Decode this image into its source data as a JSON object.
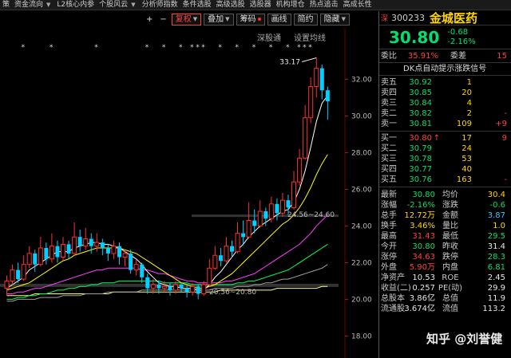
{
  "menu": [
    {
      "label": "策",
      "caret": false
    },
    {
      "label": "资金流向",
      "caret": true
    },
    {
      "label": "L2核心内参",
      "caret": false
    },
    {
      "label": "个股风云",
      "caret": true
    },
    {
      "label": "分析师指数",
      "caret": false
    },
    {
      "label": "条件选股",
      "caret": false
    },
    {
      "label": "高级选股",
      "caret": false
    },
    {
      "label": "选股器",
      "caret": false
    },
    {
      "label": "机构增仓",
      "caret": false
    },
    {
      "label": "热点追击",
      "caret": false
    },
    {
      "label": "高成长性",
      "caret": false
    }
  ],
  "toolbar": {
    "plus": "+",
    "minus": "−",
    "fuquan": "复权",
    "diejia": "叠加",
    "chouma": "筹码",
    "huaxian": "画线",
    "jianyue": "简约",
    "yincang": "隐藏"
  },
  "chart": {
    "deep_link": "深股通",
    "settings": "设置均线",
    "max_label": "33.17",
    "mid_label": "24.56~24.60",
    "low_label": "20.56~20.80",
    "ticks": [
      {
        "v": 32.0,
        "label": "32.00"
      },
      {
        "v": 30.0,
        "label": "30.00"
      },
      {
        "v": 28.0,
        "label": "28.00"
      },
      {
        "v": 26.0,
        "label": "26.00"
      },
      {
        "v": 24.0,
        "label": "24.00"
      },
      {
        "v": 22.0,
        "label": "22.00"
      },
      {
        "v": 20.0,
        "label": "20.00"
      },
      {
        "v": 18.0,
        "label": "18.00"
      }
    ]
  },
  "chart_data": {
    "type": "candlestick",
    "title": "",
    "ylim": [
      16.8,
      34.8
    ],
    "candles": [
      [
        20.6,
        21.0,
        21.3,
        20.2
      ],
      [
        21.0,
        21.6,
        21.9,
        20.8
      ],
      [
        21.6,
        21.1,
        22.0,
        20.9
      ],
      [
        21.1,
        21.9,
        22.4,
        21.0
      ],
      [
        21.9,
        22.5,
        22.9,
        21.7
      ],
      [
        22.5,
        21.9,
        22.7,
        21.5
      ],
      [
        21.9,
        22.8,
        23.4,
        21.8
      ],
      [
        22.8,
        22.2,
        23.1,
        21.9
      ],
      [
        22.2,
        22.9,
        23.6,
        22.0
      ],
      [
        22.9,
        22.3,
        23.2,
        22.0
      ],
      [
        22.3,
        23.0,
        23.4,
        22.1
      ],
      [
        23.0,
        22.5,
        23.2,
        22.2
      ],
      [
        22.5,
        23.4,
        24.2,
        22.4
      ],
      [
        23.4,
        22.9,
        23.8,
        22.6
      ],
      [
        22.9,
        23.3,
        23.9,
        22.7
      ],
      [
        23.3,
        22.9,
        23.6,
        22.5
      ],
      [
        22.9,
        23.1,
        23.6,
        22.6
      ],
      [
        23.1,
        22.8,
        23.3,
        22.4
      ],
      [
        22.8,
        22.5,
        23.0,
        22.1
      ],
      [
        22.5,
        22.9,
        23.2,
        22.2
      ],
      [
        22.9,
        22.3,
        23.1,
        21.9
      ],
      [
        22.3,
        22.5,
        22.7,
        21.8
      ],
      [
        22.5,
        21.6,
        22.7,
        21.4
      ],
      [
        21.6,
        21.9,
        22.2,
        21.3
      ],
      [
        21.9,
        21.2,
        22.0,
        20.9
      ],
      [
        21.2,
        20.6,
        21.4,
        20.3
      ],
      [
        20.6,
        20.8,
        21.1,
        20.3
      ],
      [
        20.8,
        20.6,
        21.0,
        20.3
      ],
      [
        20.6,
        20.7,
        21.0,
        20.4
      ],
      [
        20.7,
        20.5,
        20.9,
        20.2
      ],
      [
        20.5,
        20.8,
        21.0,
        20.3
      ],
      [
        20.8,
        20.6,
        20.9,
        20.4
      ],
      [
        20.6,
        20.4,
        20.8,
        20.1
      ],
      [
        20.4,
        20.7,
        20.9,
        20.2
      ],
      [
        20.7,
        20.3,
        20.8,
        20.0
      ],
      [
        20.3,
        20.8,
        21.0,
        20.2
      ],
      [
        20.8,
        21.7,
        22.2,
        20.7
      ],
      [
        21.7,
        22.4,
        22.9,
        21.6
      ],
      [
        22.4,
        22.1,
        22.8,
        21.8
      ],
      [
        22.1,
        22.9,
        23.4,
        22.0
      ],
      [
        22.9,
        22.6,
        23.2,
        22.3
      ],
      [
        22.6,
        23.6,
        24.2,
        22.5
      ],
      [
        23.6,
        23.4,
        24.3,
        23.0
      ],
      [
        23.4,
        24.3,
        25.3,
        23.3
      ],
      [
        24.3,
        24.0,
        24.9,
        23.6
      ],
      [
        24.0,
        24.8,
        25.4,
        23.9
      ],
      [
        24.8,
        24.4,
        25.0,
        24.0
      ],
      [
        24.4,
        25.2,
        25.6,
        24.2
      ],
      [
        25.2,
        24.7,
        25.5,
        24.3
      ],
      [
        24.7,
        25.4,
        25.8,
        24.5
      ],
      [
        25.4,
        25.0,
        25.7,
        24.6
      ],
      [
        25.0,
        26.4,
        27.0,
        24.9
      ],
      [
        26.4,
        27.7,
        28.2,
        26.2
      ],
      [
        27.7,
        29.9,
        30.6,
        27.6
      ],
      [
        29.9,
        31.6,
        32.1,
        29.6
      ],
      [
        31.6,
        32.6,
        33.17,
        31.0
      ],
      [
        32.6,
        31.4,
        32.8,
        30.9
      ],
      [
        31.4,
        30.8,
        31.6,
        29.8
      ]
    ],
    "ma5": [
      20.6,
      20.8,
      21.0,
      21.2,
      21.6,
      21.8,
      22.0,
      22.2,
      22.4,
      22.6,
      22.6,
      22.6,
      22.8,
      22.9,
      23.0,
      23.1,
      23.1,
      23.0,
      23.0,
      22.9,
      22.8,
      22.6,
      22.4,
      22.2,
      21.9,
      21.5,
      21.2,
      20.9,
      20.8,
      20.7,
      20.7,
      20.6,
      20.6,
      20.6,
      20.5,
      20.5,
      20.8,
      21.2,
      21.5,
      21.9,
      22.3,
      22.7,
      23.0,
      23.4,
      23.7,
      24.0,
      24.2,
      24.4,
      24.6,
      24.8,
      24.9,
      25.3,
      26.0,
      27.0,
      28.3,
      29.7,
      30.7,
      31.1
    ],
    "ma10": [
      20.5,
      20.6,
      20.7,
      20.8,
      20.9,
      21.1,
      21.3,
      21.5,
      21.7,
      21.9,
      22.1,
      22.2,
      22.4,
      22.5,
      22.6,
      22.7,
      22.8,
      22.8,
      22.8,
      22.8,
      22.8,
      22.7,
      22.6,
      22.5,
      22.3,
      22.1,
      21.9,
      21.7,
      21.5,
      21.3,
      21.1,
      20.9,
      20.8,
      20.7,
      20.6,
      20.6,
      20.7,
      20.8,
      21.0,
      21.2,
      21.4,
      21.7,
      22.0,
      22.3,
      22.6,
      22.9,
      23.2,
      23.5,
      23.8,
      24.1,
      24.3,
      24.6,
      25.0,
      25.5,
      26.1,
      26.8,
      27.4,
      27.9
    ],
    "ma20": [
      20.3,
      20.3,
      20.4,
      20.4,
      20.5,
      20.6,
      20.6,
      20.7,
      20.8,
      20.9,
      21.0,
      21.1,
      21.2,
      21.3,
      21.4,
      21.5,
      21.6,
      21.6,
      21.7,
      21.7,
      21.7,
      21.7,
      21.7,
      21.7,
      21.6,
      21.6,
      21.5,
      21.4,
      21.4,
      21.3,
      21.2,
      21.1,
      21.0,
      21.0,
      20.9,
      20.9,
      20.9,
      20.9,
      20.9,
      21.0,
      21.0,
      21.1,
      21.2,
      21.3,
      21.4,
      21.6,
      21.8,
      22.0,
      22.2,
      22.4,
      22.6,
      22.8,
      23.0,
      23.3,
      23.6,
      24.0,
      24.3,
      24.6
    ],
    "ma30": [
      20.0,
      20.0,
      20.1,
      20.1,
      20.2,
      20.2,
      20.3,
      20.3,
      20.4,
      20.5,
      20.5,
      20.6,
      20.6,
      20.7,
      20.7,
      20.8,
      20.8,
      20.9,
      20.9,
      20.9,
      21.0,
      21.0,
      21.0,
      21.0,
      21.0,
      21.0,
      21.0,
      21.0,
      20.9,
      20.9,
      20.9,
      20.9,
      20.9,
      20.8,
      20.8,
      20.8,
      20.8,
      20.8,
      20.8,
      20.8,
      20.8,
      20.9,
      20.9,
      21.0,
      21.0,
      21.1,
      21.2,
      21.3,
      21.4,
      21.5,
      21.6,
      21.8,
      22.0,
      22.2,
      22.4,
      22.6,
      22.8,
      23.0
    ],
    "ma60": [
      19.9,
      19.9,
      20.0,
      20.0,
      20.0,
      20.0,
      20.1,
      20.1,
      20.1,
      20.1,
      20.2,
      20.2,
      20.2,
      20.2,
      20.3,
      20.3,
      20.3,
      20.3,
      20.4,
      20.4,
      20.4,
      20.4,
      20.4,
      20.4,
      20.5,
      20.5,
      20.5,
      20.5,
      20.5,
      20.5,
      20.5,
      20.5,
      20.5,
      20.5,
      20.5,
      20.5,
      20.5,
      20.6,
      20.6,
      20.6,
      20.6,
      20.7,
      20.7,
      20.7,
      20.8,
      20.8,
      20.9,
      20.9,
      21.0,
      21.1,
      21.1,
      21.2,
      21.3,
      21.4,
      21.5,
      21.6,
      21.7,
      21.9
    ],
    "ma120": [
      20.2,
      20.2,
      20.2,
      20.2,
      20.2,
      20.3,
      20.3,
      20.3,
      20.3,
      20.3,
      20.3,
      20.3,
      20.3,
      20.3,
      20.3,
      20.3,
      20.3,
      20.3,
      20.3,
      20.4,
      20.4,
      20.4,
      20.4,
      20.4,
      20.4,
      20.4,
      20.4,
      20.4,
      20.4,
      20.4,
      20.4,
      20.4,
      20.4,
      20.4,
      20.4,
      20.4,
      20.4,
      20.4,
      20.5,
      20.5,
      20.5,
      20.5,
      20.5,
      20.5,
      20.5,
      20.5,
      20.5,
      20.5,
      20.6,
      20.6,
      20.6,
      20.6,
      20.6,
      20.6,
      20.6,
      20.6,
      20.7,
      20.7
    ],
    "colors": {
      "up": "#ff3030",
      "down": "#00d0ff",
      "ma5": "#ffffff",
      "ma10": "#ffff00",
      "ma20": "#ff40ff",
      "ma30": "#00ff60",
      "ma60": "#a0a0a0",
      "ma120": "#ffff80"
    },
    "markers": [
      3,
      8,
      16,
      25,
      28,
      31,
      33,
      34,
      35,
      38,
      41,
      44,
      47,
      50,
      52,
      53,
      54
    ]
  },
  "stock": {
    "market": "深",
    "code": "300233",
    "name": "金城医药",
    "price": "30.80",
    "change": "-0.68",
    "pct": "-2.16%",
    "weibi_label": "委比",
    "weibi_val": "35.91%",
    "weicha_label": "委差",
    "weicha_val": "15",
    "signal": "DK点自动提示涨跌信号"
  },
  "asks": [
    {
      "label": "卖五",
      "price": "30.92",
      "vol": "1",
      "arrow": "",
      "chg": ""
    },
    {
      "label": "卖四",
      "price": "30.85",
      "vol": "20",
      "arrow": "",
      "chg": ""
    },
    {
      "label": "卖三",
      "price": "30.84",
      "vol": "4",
      "arrow": "",
      "chg": ""
    },
    {
      "label": "卖二",
      "price": "30.82",
      "vol": "2",
      "arrow": "",
      "chg": "-"
    },
    {
      "label": "卖一",
      "price": "30.81",
      "vol": "109",
      "arrow": "",
      "chg": "+9"
    }
  ],
  "bids": [
    {
      "label": "买一",
      "price": "30.80",
      "vol": "17",
      "arrow": "↑",
      "chg": "9"
    },
    {
      "label": "买二",
      "price": "30.79",
      "vol": "24",
      "arrow": "",
      "chg": ""
    },
    {
      "label": "买三",
      "price": "30.78",
      "vol": "53",
      "arrow": "",
      "chg": ""
    },
    {
      "label": "买四",
      "price": "30.77",
      "vol": "40",
      "arrow": "",
      "chg": ""
    },
    {
      "label": "买五",
      "price": "30.76",
      "vol": "163",
      "arrow": "",
      "chg": "-"
    }
  ],
  "quotes": [
    {
      "l1": "最新",
      "v1": "30.80",
      "c1": "green",
      "l2": "均价",
      "v2": "30.4",
      "c2": "yellow"
    },
    {
      "l1": "涨幅",
      "v1": "-2.16%",
      "c1": "green",
      "l2": "涨跌",
      "v2": "-0.6",
      "c2": "green"
    },
    {
      "l1": "总手",
      "v1": "12.72万",
      "c1": "yellow",
      "l2": "金额",
      "v2": "3.87",
      "c2": "cyan"
    },
    {
      "l1": "换手",
      "v1": "3.46%",
      "c1": "yellow",
      "l2": "量比",
      "v2": "1.0",
      "c2": "yellow"
    },
    {
      "l1": "最高",
      "v1": "31.43",
      "c1": "red",
      "l2": "最低",
      "v2": "29.5",
      "c2": "green"
    },
    {
      "l1": "今开",
      "v1": "30.80",
      "c1": "green",
      "l2": "昨收",
      "v2": "31.4",
      "c2": "white"
    },
    {
      "l1": "涨停",
      "v1": "34.63",
      "c1": "red",
      "l2": "跌停",
      "v2": "28.3",
      "c2": "green"
    },
    {
      "l1": "外盘",
      "v1": "5.90万",
      "c1": "red",
      "l2": "内盘",
      "v2": "6.81",
      "c2": "green"
    },
    {
      "l1": "净资产",
      "v1": "10.53",
      "c1": "white",
      "l2": "ROE",
      "v2": "2.45",
      "c2": "white"
    },
    {
      "l1": "收益(二)",
      "v1": "0.257",
      "c1": "white",
      "l2": "PE(动)",
      "v2": "29.9",
      "c2": "white"
    },
    {
      "l1": "总股本",
      "v1": "3.86亿",
      "c1": "white",
      "l2": "总值",
      "v2": "11.9",
      "c2": "white"
    },
    {
      "l1": "流通股",
      "v1": "3.674亿",
      "c1": "white",
      "l2": "流值",
      "v2": "113.2",
      "c2": "white"
    }
  ],
  "watermark": "知乎 @刘誉健"
}
